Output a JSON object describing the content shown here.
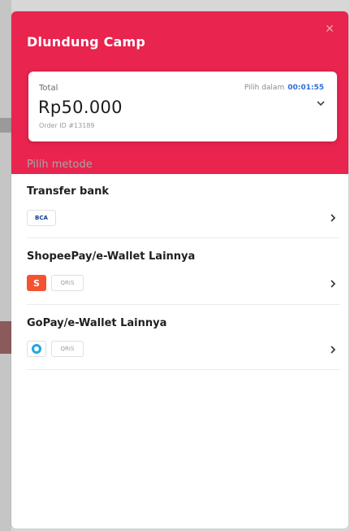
{
  "colors": {
    "brand": "#e8244f",
    "timer": "#2f6bd6",
    "shopee": "#f3532f",
    "gopay": "#22a7e0"
  },
  "header": {
    "title": "Dlundung Camp",
    "close_icon": "close-icon"
  },
  "summary": {
    "total_label": "Total",
    "amount": "Rp50.000",
    "order_id": "Order ID #13189",
    "pay_within_label": "Pilih dalam",
    "timer": "00:01:55",
    "expand_icon": "chevron-down-icon"
  },
  "methods_heading": "Pilih metode",
  "methods": [
    {
      "title": "Transfer bank",
      "logos": [
        {
          "icon": "bca-logo",
          "text": "BCA"
        }
      ],
      "nav_icon": "chevron-right-icon"
    },
    {
      "title": "ShopeePay/e-Wallet Lainnya",
      "logos": [
        {
          "icon": "shopeepay-logo",
          "text": "S"
        },
        {
          "icon": "qris-logo",
          "text": "QRIS"
        }
      ],
      "nav_icon": "chevron-right-icon"
    },
    {
      "title": "GoPay/e-Wallet Lainnya",
      "logos": [
        {
          "icon": "gopay-logo",
          "text": ""
        },
        {
          "icon": "qris-logo",
          "text": "QRIS"
        }
      ],
      "nav_icon": "chevron-right-icon"
    }
  ]
}
